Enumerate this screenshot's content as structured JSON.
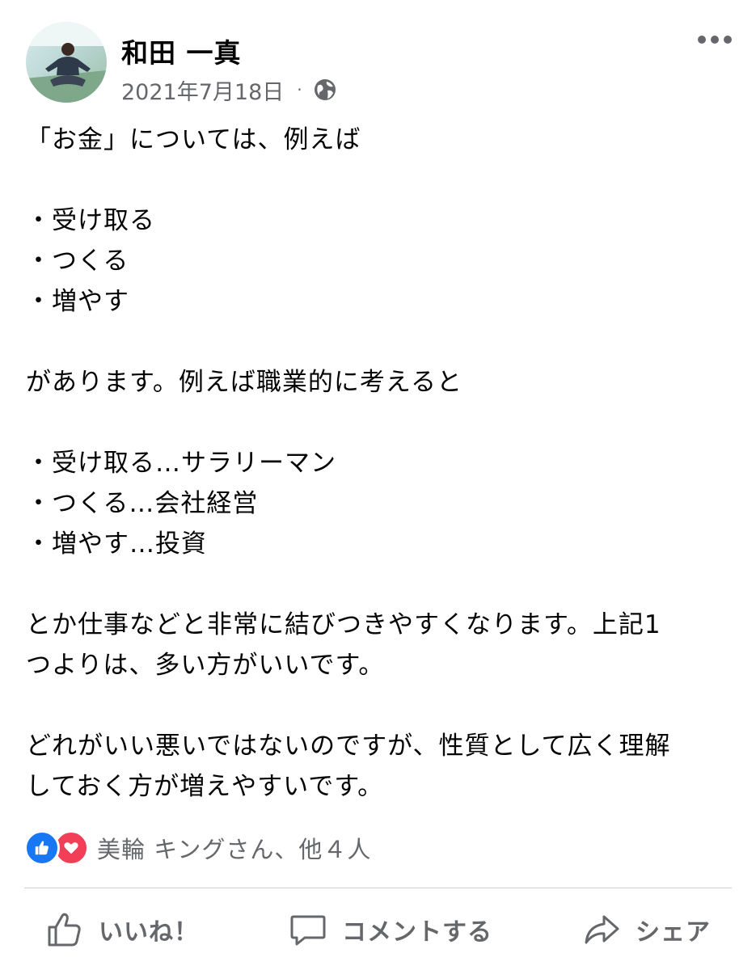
{
  "post": {
    "author": "和田 一真",
    "date": "2021年7月18日",
    "separator": "·",
    "privacy_icon": "globe-icon",
    "more_icon": "more-options-icon",
    "lines": [
      "「お金」については、例えば",
      "",
      "・受け取る",
      "・つくる",
      "・増やす",
      "",
      "があります。例えば職業的に考えると",
      "",
      "・受け取る…サラリーマン",
      "・つくる…会社経営",
      "・増やす…投資",
      "",
      "とか仕事などと非常に結びつきやすくなります。上記1",
      "つよりは、多い方がいいです。",
      "",
      "どれがいい悪いではないのですが、性質として広く理解",
      "しておく方が増えやすいです。"
    ]
  },
  "reactions": {
    "icons": [
      "like-reaction-icon",
      "love-reaction-icon"
    ],
    "summary": "美輪 キングさん、他４人"
  },
  "actions": {
    "like_label": "いいね！",
    "comment_label": "コメントする",
    "share_label": "シェア"
  },
  "colors": {
    "like_blue": "#1877f2",
    "love_red": "#f33e58",
    "secondary_text": "#65676b",
    "divider": "#ced0d4"
  }
}
